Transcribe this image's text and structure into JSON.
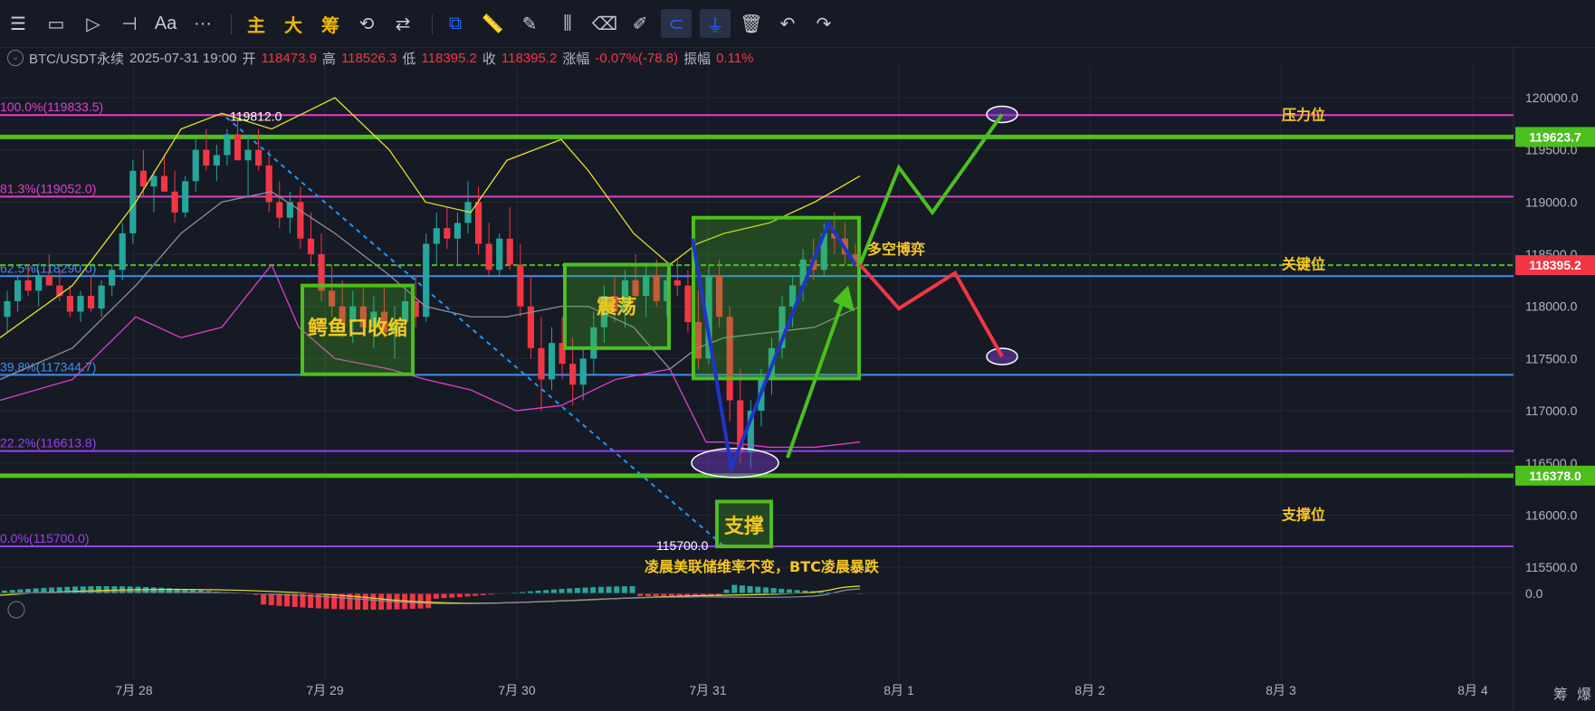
{
  "toolbar": {
    "items": [
      {
        "name": "menu-icon",
        "glyph": "☰"
      },
      {
        "name": "rectangle-icon",
        "glyph": "▭"
      },
      {
        "name": "cursor-icon",
        "glyph": "▷"
      },
      {
        "name": "line-tool-icon",
        "glyph": "⊣"
      },
      {
        "name": "text-tool-icon",
        "glyph": "Aa"
      },
      {
        "name": "more-icon",
        "glyph": "···"
      },
      {
        "name": "main-indicator-button",
        "glyph": "主"
      },
      {
        "name": "large-button",
        "glyph": "大"
      },
      {
        "name": "chips-button",
        "glyph": "筹"
      },
      {
        "name": "replay-icon",
        "glyph": "⟲"
      },
      {
        "name": "compare-icon",
        "glyph": "⇄"
      },
      {
        "name": "drawings-icon",
        "glyph": "⧉"
      },
      {
        "name": "ruler-icon",
        "glyph": "📏"
      },
      {
        "name": "pen-icon",
        "glyph": "✎"
      },
      {
        "name": "indicator-icon",
        "glyph": "⫼"
      },
      {
        "name": "trash-bin-icon",
        "glyph": "⌫"
      },
      {
        "name": "edit-icon",
        "glyph": "✐"
      },
      {
        "name": "magnet-icon",
        "glyph": "⊂"
      },
      {
        "name": "filter-icon",
        "glyph": "⏚"
      },
      {
        "name": "delete-icon",
        "glyph": "🗑"
      },
      {
        "name": "undo-icon",
        "glyph": "↶"
      },
      {
        "name": "redo-icon",
        "glyph": "↷"
      }
    ]
  },
  "info": {
    "symbol": "BTC/USDT永续",
    "datetime": "2025-07-31 19:00",
    "open_label": "开",
    "open": "118473.9",
    "high_label": "高",
    "high": "118526.3",
    "low_label": "低",
    "low": "118395.2",
    "close_label": "收",
    "close": "118395.2",
    "change_label": "涨幅",
    "change": "-0.07%(-78.8)",
    "amp_label": "振幅",
    "amp": "0.11%"
  },
  "colors": {
    "background": "#161a25",
    "up": "#26a69a",
    "down": "#f23645",
    "green_box": "#4cbf1f",
    "fib_magenta": "#e040c8",
    "fib_blue": "#3d8ef0",
    "fib_purple": "#9b40f0",
    "annotation_yellow": "#f7c821"
  },
  "chart_data": {
    "type": "candlestick",
    "symbol": "BTC/USDT永续",
    "ylim": [
      115300,
      120300
    ],
    "y_ticks": [
      115500,
      116000,
      116500,
      117000,
      117500,
      118000,
      118500,
      119000,
      119500,
      120000
    ],
    "y_tick_labels": [
      "115500.0",
      "116000.0",
      "116500.0",
      "117000.0",
      "117500.0",
      "118000.0",
      "118500.0",
      "119000.0",
      "119500.0",
      "120000.0"
    ],
    "x_tick_labels": [
      "7月 28",
      "7月 29",
      "7月 30",
      "7月 31",
      "8月 1",
      "8月 2",
      "8月 3",
      "8月 4"
    ],
    "grid": true,
    "price_tags": [
      {
        "value": 119623.7,
        "label": "119623.7",
        "color": "#4cbf1f"
      },
      {
        "value": 118395.2,
        "label": "118395.2",
        "color": "#f23645"
      },
      {
        "value": 116378.0,
        "label": "116378.0",
        "color": "#4cbf1f"
      }
    ],
    "fib_levels": [
      {
        "label": "100.0%(119833.5)",
        "value": 119833.5,
        "color": "#e040c8"
      },
      {
        "label": "81.3%(119052.0)",
        "value": 119052.0,
        "color": "#e040c8"
      },
      {
        "label": "62.5%(118290.0)",
        "value": 118290.0,
        "color": "#3d8ef0"
      },
      {
        "label": "39.8%(117344.7)",
        "value": 117344.7,
        "color": "#3d8ef0"
      },
      {
        "label": "22.2%(116613.8)",
        "value": 116613.8,
        "color": "#9b40f0"
      },
      {
        "label": "0.0%(115700.0)",
        "value": 115700.0,
        "color": "#9b40f0"
      }
    ],
    "key_levels": [
      {
        "value": 119623.7,
        "color": "#4cbf1f"
      },
      {
        "value": 118395.2,
        "color": "#4cbf1f"
      },
      {
        "value": 116378.0,
        "color": "#4cbf1f"
      }
    ],
    "level_labels": [
      {
        "text": "压力位",
        "value": 119830
      },
      {
        "text": "关键位",
        "value": 118400
      },
      {
        "text": "支撑位",
        "value": 116000
      }
    ],
    "price_markers": [
      {
        "text": "119812.0",
        "value": 119812
      },
      {
        "text": "115700.0",
        "value": 115700
      }
    ],
    "annotations": {
      "box1": "鳄鱼口收缩",
      "box2": "震荡",
      "support": "支撑",
      "bull_bear": "多空博弈",
      "news": "凌晨美联储维率不变，BTC凌晨暴跌"
    },
    "candles": [
      [
        117900,
        118150,
        117750,
        118050
      ],
      [
        118050,
        118300,
        117950,
        118250
      ],
      [
        118250,
        118400,
        118100,
        118150
      ],
      [
        118150,
        118350,
        118000,
        118300
      ],
      [
        118300,
        118500,
        118200,
        118200
      ],
      [
        118200,
        118350,
        118050,
        118100
      ],
      [
        118100,
        118200,
        117900,
        117950
      ],
      [
        117950,
        118150,
        117850,
        118100
      ],
      [
        118100,
        118300,
        117950,
        117980
      ],
      [
        117980,
        118250,
        117900,
        118200
      ],
      [
        118200,
        118400,
        118100,
        118350
      ],
      [
        118350,
        118800,
        118250,
        118700
      ],
      [
        118700,
        119400,
        118600,
        119300
      ],
      [
        119300,
        119500,
        119050,
        119150
      ],
      [
        119150,
        119300,
        118900,
        119250
      ],
      [
        119250,
        119450,
        119100,
        119100
      ],
      [
        119100,
        119300,
        118800,
        118900
      ],
      [
        118900,
        119250,
        118850,
        119200
      ],
      [
        119200,
        119600,
        119100,
        119500
      ],
      [
        119500,
        119700,
        119300,
        119350
      ],
      [
        119350,
        119550,
        119200,
        119450
      ],
      [
        119450,
        119700,
        119350,
        119650
      ],
      [
        119650,
        119812,
        119500,
        119400
      ],
      [
        119400,
        119600,
        119050,
        119500
      ],
      [
        119500,
        119700,
        119300,
        119350
      ],
      [
        119350,
        119500,
        118900,
        119000
      ],
      [
        119000,
        119200,
        118750,
        118850
      ],
      [
        118850,
        119100,
        118700,
        119000
      ],
      [
        119000,
        119150,
        118550,
        118650
      ],
      [
        118650,
        118900,
        118400,
        118500
      ],
      [
        118500,
        118700,
        118050,
        118150
      ],
      [
        118150,
        118400,
        117900,
        118000
      ],
      [
        118000,
        118250,
        117700,
        117850
      ],
      [
        117850,
        118150,
        117650,
        118000
      ],
      [
        118000,
        118200,
        117750,
        117800
      ],
      [
        117800,
        118100,
        117600,
        117950
      ],
      [
        117950,
        118200,
        117700,
        117750
      ],
      [
        117750,
        118000,
        117500,
        117850
      ],
      [
        117850,
        118150,
        117700,
        118050
      ],
      [
        118050,
        118300,
        117800,
        117900
      ],
      [
        117900,
        118700,
        117850,
        118600
      ],
      [
        118600,
        118900,
        118400,
        118750
      ],
      [
        118750,
        118950,
        118550,
        118650
      ],
      [
        118650,
        118900,
        118400,
        118800
      ],
      [
        118800,
        119200,
        118700,
        119000
      ],
      [
        119000,
        119150,
        118500,
        118600
      ],
      [
        118600,
        118800,
        118300,
        118350
      ],
      [
        118350,
        118700,
        118300,
        118650
      ],
      [
        118650,
        118950,
        118350,
        118400
      ],
      [
        118400,
        118600,
        117900,
        118000
      ],
      [
        118000,
        118300,
        117500,
        117600
      ],
      [
        117600,
        117900,
        117000,
        117300
      ],
      [
        117300,
        117800,
        117200,
        117650
      ],
      [
        117650,
        117900,
        117300,
        117450
      ],
      [
        117450,
        117700,
        117050,
        117250
      ],
      [
        117250,
        117600,
        117100,
        117500
      ],
      [
        117500,
        117950,
        117350,
        117800
      ],
      [
        117800,
        118200,
        117650,
        118100
      ],
      [
        118100,
        118300,
        117850,
        117950
      ],
      [
        117950,
        118350,
        117800,
        118250
      ],
      [
        118250,
        118500,
        118050,
        118100
      ],
      [
        118100,
        118400,
        117900,
        118300
      ],
      [
        118300,
        118450,
        118000,
        118050
      ],
      [
        118050,
        118300,
        117900,
        118250
      ],
      [
        118250,
        118450,
        118100,
        118200
      ],
      [
        118200,
        118350,
        117750,
        117850
      ],
      [
        117850,
        118150,
        117400,
        117500
      ],
      [
        117500,
        118400,
        117450,
        118300
      ],
      [
        118300,
        118450,
        117800,
        117900
      ],
      [
        117900,
        118000,
        116900,
        117100
      ],
      [
        117100,
        117400,
        116500,
        116600
      ],
      [
        116600,
        117100,
        116450,
        117000
      ],
      [
        117000,
        117400,
        116850,
        117300
      ],
      [
        117300,
        117700,
        117150,
        117600
      ],
      [
        117600,
        118100,
        117500,
        118000
      ],
      [
        118000,
        118300,
        117800,
        118200
      ],
      [
        118200,
        118550,
        118050,
        118450
      ],
      [
        118450,
        118650,
        118250,
        118350
      ],
      [
        118350,
        118800,
        118300,
        118700
      ],
      [
        118700,
        118900,
        118500,
        118650
      ],
      [
        118650,
        118800,
        118400,
        118500
      ],
      [
        118500,
        118600,
        118395,
        118395
      ]
    ],
    "indicator_pane": {
      "type": "histogram",
      "zero_label": "0.0"
    }
  },
  "corner": {
    "left": "筹",
    "right": "爆"
  }
}
